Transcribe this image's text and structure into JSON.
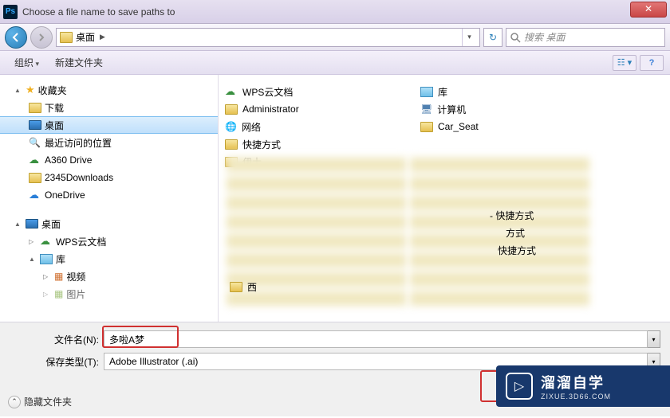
{
  "window": {
    "title": "Choose a file name to save paths to",
    "app_icon": "Ps"
  },
  "nav": {
    "location": "桌面",
    "location_sep": "▶",
    "search_placeholder": "搜索 桌面"
  },
  "toolbar": {
    "organize": "组织",
    "new_folder": "新建文件夹"
  },
  "sidebar": {
    "favorites": "收藏夹",
    "downloads": "下载",
    "desktop": "桌面",
    "recent": "最近访问的位置",
    "a360": "A360 Drive",
    "dl2345": "2345Downloads",
    "onedrive": "OneDrive",
    "desktop2": "桌面",
    "wps": "WPS云文档",
    "library": "库",
    "video": "视频",
    "pictures": "图片"
  },
  "files": {
    "col1": [
      {
        "icon": "cloud",
        "label": "WPS云文档"
      },
      {
        "icon": "folder",
        "label": "Administrator"
      },
      {
        "icon": "net",
        "label": "网络"
      },
      {
        "icon": "folder",
        "label": "快捷方式"
      },
      {
        "icon": "folder",
        "label": "伊士"
      }
    ],
    "col2": [
      {
        "icon": "lib",
        "label": "库"
      },
      {
        "icon": "pc",
        "label": "计算机"
      },
      {
        "icon": "folder",
        "label": "Car_Seat"
      }
    ],
    "partial1": "西",
    "partial_right": [
      "- 快捷方式",
      "方式",
      "快捷方式"
    ]
  },
  "form": {
    "filename_label": "文件名(N):",
    "filename_value": "多啦A梦",
    "savetype_label": "保存类型(T):",
    "savetype_value": "Adobe Illustrator (.ai)",
    "hide_folders": "隐藏文件夹"
  },
  "watermark": {
    "main": "溜溜自学",
    "sub": "ZIXUE.3D66.COM",
    "icon": "▷"
  }
}
